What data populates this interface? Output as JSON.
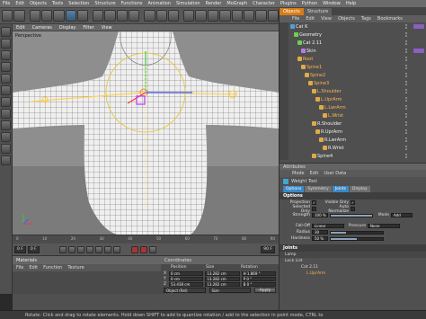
{
  "menubar": [
    "File",
    "Edit",
    "Objects",
    "Tools",
    "Selection",
    "Structure",
    "Functions",
    "Animation",
    "Simulation",
    "Render",
    "MoGraph",
    "Character",
    "Plugins",
    "Python",
    "Window",
    "Help"
  ],
  "viewport": {
    "menu": [
      "Edit",
      "Cameras",
      "Display",
      "Filter",
      "View"
    ],
    "label": "Perspective"
  },
  "timeline": {
    "ticks": [
      "0",
      "10",
      "20",
      "30",
      "40",
      "50",
      "60",
      "70",
      "80",
      "90"
    ],
    "start_frame": "0 F",
    "current_frame": "0 F",
    "end_frame": "90 F"
  },
  "materials": {
    "title": "Materials",
    "menu": [
      "File",
      "Edit",
      "Function",
      "Texture"
    ]
  },
  "coordinates": {
    "title": "Coordinates",
    "columns": [
      "Position",
      "Size",
      "Rotation"
    ],
    "rows": [
      {
        "axis": "X",
        "pos": "0 cm",
        "size": "13.282 cm",
        "rot": "H 1.869 °"
      },
      {
        "axis": "Y",
        "pos": "0 cm",
        "size": "13.282 cm",
        "rot": "P 0 °"
      },
      {
        "axis": "Z",
        "pos": "53.438 cm",
        "size": "13.282 cm",
        "rot": "B 0 °"
      }
    ],
    "mode_select": "Object (Rel)",
    "size_select": "Size",
    "apply_label": "Apply"
  },
  "status": "Rotate: Click and drag to rotate elements. Hold down SHIFT to add to quantize rotation / add to the selection in point mode, CTRL to",
  "object_manager": {
    "tabs": [
      "Objects",
      "Structure"
    ],
    "menu": [
      "File",
      "Edit",
      "View",
      "Objects",
      "Tags",
      "Bookmarks"
    ],
    "items": [
      {
        "name": "Cat K",
        "indent": 0,
        "icon": "#4aa3df",
        "selected": false,
        "tag": true
      },
      {
        "name": "Geometry",
        "indent": 1,
        "icon": "#6fcf55",
        "selected": false,
        "tag": false
      },
      {
        "name": "Cat 2.11",
        "indent": 2,
        "icon": "#6fcf55",
        "selected": false,
        "tag": false
      },
      {
        "name": "Skin",
        "indent": 3,
        "icon": "#b77de0",
        "selected": false,
        "tag": true
      },
      {
        "name": "Root",
        "indent": 2,
        "icon": "#e0a94a",
        "selected": true,
        "tag": false
      },
      {
        "name": "Spine1",
        "indent": 3,
        "icon": "#e0a94a",
        "selected": true,
        "tag": false
      },
      {
        "name": "Spine2",
        "indent": 4,
        "icon": "#e0a94a",
        "selected": true,
        "tag": false
      },
      {
        "name": "Spine3",
        "indent": 5,
        "icon": "#e0a94a",
        "selected": true,
        "tag": false
      },
      {
        "name": "L.Shoulder",
        "indent": 6,
        "icon": "#e0a94a",
        "selected": true,
        "tag": false
      },
      {
        "name": "L.UprArm",
        "indent": 7,
        "icon": "#e0a94a",
        "selected": true,
        "tag": false
      },
      {
        "name": "L.LwrArm",
        "indent": 8,
        "icon": "#e0a94a",
        "selected": true,
        "tag": false
      },
      {
        "name": "L.Wrist",
        "indent": 9,
        "icon": "#e0a94a",
        "selected": true,
        "tag": false
      },
      {
        "name": "R.Shoulder",
        "indent": 6,
        "icon": "#e0a94a",
        "selected": false,
        "tag": false
      },
      {
        "name": "R.UprArm",
        "indent": 7,
        "icon": "#e0a94a",
        "selected": false,
        "tag": false
      },
      {
        "name": "R.LwrArm",
        "indent": 8,
        "icon": "#e0a94a",
        "selected": false,
        "tag": false
      },
      {
        "name": "R.Wrist",
        "indent": 9,
        "icon": "#e0a94a",
        "selected": false,
        "tag": false
      },
      {
        "name": "Spine4",
        "indent": 6,
        "icon": "#e0a94a",
        "selected": false,
        "tag": false
      }
    ]
  },
  "attributes": {
    "title": "Attributes",
    "menu": [
      "Mode",
      "Edit",
      "User Data"
    ],
    "tool_name": "Weight Tool",
    "subtabs": [
      "Options",
      "Symmetry",
      "Joints",
      "Display"
    ],
    "options_title": "Options",
    "projection_label": "Projection",
    "visible_only_label": "Visible Only",
    "selected_only_label": "Selected Only",
    "auto_normalize_label": "Auto Normalize",
    "strength_label": "Strength",
    "strength_value": "100 %",
    "mode_label": "Mode",
    "mode_value": "Add",
    "falloff_label": "Fall-Off",
    "falloff_value": "Linear",
    "pressure_label": "Pressure",
    "pressure_value": "None",
    "radius_label": "Radius",
    "radius_value": "30",
    "hardness_label": "Hardness",
    "hardness_value": "50 %",
    "joints_title": "Joints",
    "lamp_title": "Lamp",
    "lock_list_label": "Lock List",
    "lock_item": "Cat 2.11",
    "last_item": "L.UprArm"
  },
  "colors": {
    "accent_orange": "#d97b17",
    "selection_orange": "#ffb454",
    "joint_blue": "#3b88c6",
    "mesh_white": "#f2f2f2"
  }
}
